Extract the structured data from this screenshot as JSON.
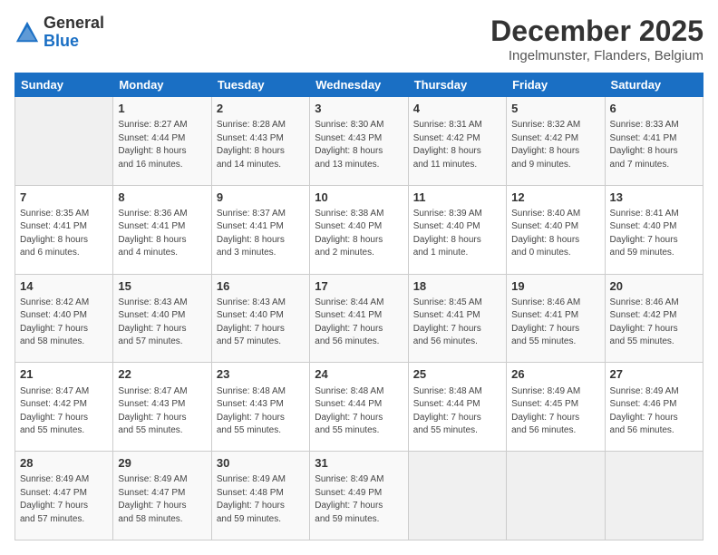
{
  "header": {
    "logo_general": "General",
    "logo_blue": "Blue",
    "month_title": "December 2025",
    "location": "Ingelmunster, Flanders, Belgium"
  },
  "weekdays": [
    "Sunday",
    "Monday",
    "Tuesday",
    "Wednesday",
    "Thursday",
    "Friday",
    "Saturday"
  ],
  "weeks": [
    [
      {
        "day": "",
        "info": ""
      },
      {
        "day": "1",
        "info": "Sunrise: 8:27 AM\nSunset: 4:44 PM\nDaylight: 8 hours\nand 16 minutes."
      },
      {
        "day": "2",
        "info": "Sunrise: 8:28 AM\nSunset: 4:43 PM\nDaylight: 8 hours\nand 14 minutes."
      },
      {
        "day": "3",
        "info": "Sunrise: 8:30 AM\nSunset: 4:43 PM\nDaylight: 8 hours\nand 13 minutes."
      },
      {
        "day": "4",
        "info": "Sunrise: 8:31 AM\nSunset: 4:42 PM\nDaylight: 8 hours\nand 11 minutes."
      },
      {
        "day": "5",
        "info": "Sunrise: 8:32 AM\nSunset: 4:42 PM\nDaylight: 8 hours\nand 9 minutes."
      },
      {
        "day": "6",
        "info": "Sunrise: 8:33 AM\nSunset: 4:41 PM\nDaylight: 8 hours\nand 7 minutes."
      }
    ],
    [
      {
        "day": "7",
        "info": "Sunrise: 8:35 AM\nSunset: 4:41 PM\nDaylight: 8 hours\nand 6 minutes."
      },
      {
        "day": "8",
        "info": "Sunrise: 8:36 AM\nSunset: 4:41 PM\nDaylight: 8 hours\nand 4 minutes."
      },
      {
        "day": "9",
        "info": "Sunrise: 8:37 AM\nSunset: 4:41 PM\nDaylight: 8 hours\nand 3 minutes."
      },
      {
        "day": "10",
        "info": "Sunrise: 8:38 AM\nSunset: 4:40 PM\nDaylight: 8 hours\nand 2 minutes."
      },
      {
        "day": "11",
        "info": "Sunrise: 8:39 AM\nSunset: 4:40 PM\nDaylight: 8 hours\nand 1 minute."
      },
      {
        "day": "12",
        "info": "Sunrise: 8:40 AM\nSunset: 4:40 PM\nDaylight: 8 hours\nand 0 minutes."
      },
      {
        "day": "13",
        "info": "Sunrise: 8:41 AM\nSunset: 4:40 PM\nDaylight: 7 hours\nand 59 minutes."
      }
    ],
    [
      {
        "day": "14",
        "info": "Sunrise: 8:42 AM\nSunset: 4:40 PM\nDaylight: 7 hours\nand 58 minutes."
      },
      {
        "day": "15",
        "info": "Sunrise: 8:43 AM\nSunset: 4:40 PM\nDaylight: 7 hours\nand 57 minutes."
      },
      {
        "day": "16",
        "info": "Sunrise: 8:43 AM\nSunset: 4:40 PM\nDaylight: 7 hours\nand 57 minutes."
      },
      {
        "day": "17",
        "info": "Sunrise: 8:44 AM\nSunset: 4:41 PM\nDaylight: 7 hours\nand 56 minutes."
      },
      {
        "day": "18",
        "info": "Sunrise: 8:45 AM\nSunset: 4:41 PM\nDaylight: 7 hours\nand 56 minutes."
      },
      {
        "day": "19",
        "info": "Sunrise: 8:46 AM\nSunset: 4:41 PM\nDaylight: 7 hours\nand 55 minutes."
      },
      {
        "day": "20",
        "info": "Sunrise: 8:46 AM\nSunset: 4:42 PM\nDaylight: 7 hours\nand 55 minutes."
      }
    ],
    [
      {
        "day": "21",
        "info": "Sunrise: 8:47 AM\nSunset: 4:42 PM\nDaylight: 7 hours\nand 55 minutes."
      },
      {
        "day": "22",
        "info": "Sunrise: 8:47 AM\nSunset: 4:43 PM\nDaylight: 7 hours\nand 55 minutes."
      },
      {
        "day": "23",
        "info": "Sunrise: 8:48 AM\nSunset: 4:43 PM\nDaylight: 7 hours\nand 55 minutes."
      },
      {
        "day": "24",
        "info": "Sunrise: 8:48 AM\nSunset: 4:44 PM\nDaylight: 7 hours\nand 55 minutes."
      },
      {
        "day": "25",
        "info": "Sunrise: 8:48 AM\nSunset: 4:44 PM\nDaylight: 7 hours\nand 55 minutes."
      },
      {
        "day": "26",
        "info": "Sunrise: 8:49 AM\nSunset: 4:45 PM\nDaylight: 7 hours\nand 56 minutes."
      },
      {
        "day": "27",
        "info": "Sunrise: 8:49 AM\nSunset: 4:46 PM\nDaylight: 7 hours\nand 56 minutes."
      }
    ],
    [
      {
        "day": "28",
        "info": "Sunrise: 8:49 AM\nSunset: 4:47 PM\nDaylight: 7 hours\nand 57 minutes."
      },
      {
        "day": "29",
        "info": "Sunrise: 8:49 AM\nSunset: 4:47 PM\nDaylight: 7 hours\nand 58 minutes."
      },
      {
        "day": "30",
        "info": "Sunrise: 8:49 AM\nSunset: 4:48 PM\nDaylight: 7 hours\nand 59 minutes."
      },
      {
        "day": "31",
        "info": "Sunrise: 8:49 AM\nSunset: 4:49 PM\nDaylight: 7 hours\nand 59 minutes."
      },
      {
        "day": "",
        "info": ""
      },
      {
        "day": "",
        "info": ""
      },
      {
        "day": "",
        "info": ""
      }
    ]
  ]
}
